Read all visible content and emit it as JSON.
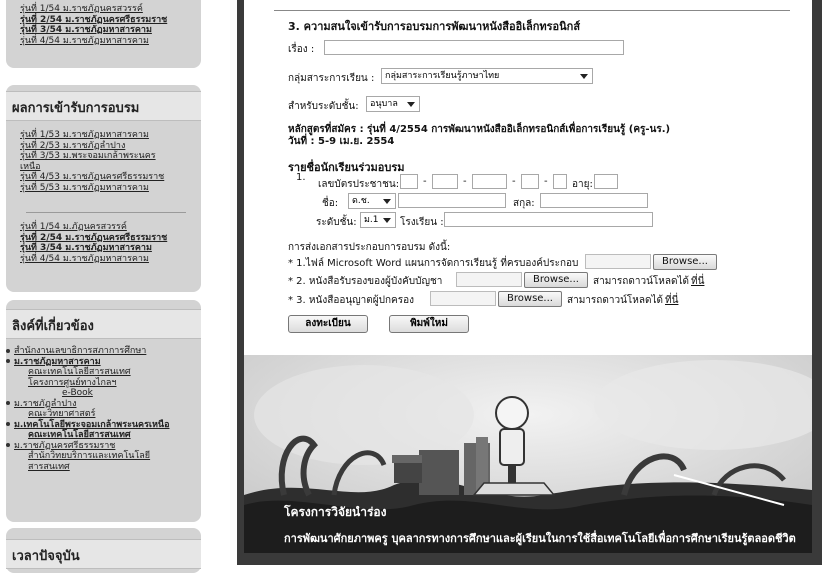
{
  "sidebar": {
    "top_links": [
      "รุ่นที่ 1/54 ม.ราชภัฏนครสวรรค์",
      "รุ่นที่ 2/54 ม.ราชภัฏนครศรีธรรมราช",
      "รุ่นที่ 3/54 ม.ราชภัฏมหาสารคาม",
      "รุ่นที่ 4/54 ม.ราชภัฏมหาสารคาม"
    ],
    "results_title": "ผลการเข้ารับการอบรม",
    "results_links_53": [
      "รุ่นที่ 1/53 ม.ราชภัฏมหาสารคาม",
      "รุ่นที่ 2/53 ม.ราชภัฏลำปาง",
      "รุ่นที่ 3/53 ม.พระจอมเกล้าพระนคร",
      "เหนือ",
      "รุ่นที่ 4/53 ม.ราชภัฏนครศรีธรรมราช",
      "รุ่นที่ 5/53 ม.ราชภัฏมหาสารคาม"
    ],
    "results_links_54": [
      "รุ่นที่ 1/54 ม.ภัฏนครสวรรค์",
      "รุ่นที่ 2/54 ม.ราชภัฏนครศรีธรรมราช",
      "รุ่นที่ 3/54 ม.ราชภัฏมหาสารคาม",
      "รุ่นที่ 4/54 ม.ราชภัฏมหาสารคาม"
    ],
    "related_title": "ลิงค์ที่เกี่ยวข้อง",
    "related": [
      {
        "label": "สำนักงานเลขาธิการสภาการศึกษา",
        "subs": []
      },
      {
        "label": "ม.ราชภัฏมหาสารคาม",
        "subs": [
          "คณะเทคโนโลยีสารสนเทศ",
          "โครงการศูนย์ทางไกลฯ",
          "e-Book"
        ]
      },
      {
        "label": "ม.ราชภัฏลำปาง",
        "subs": [
          "คณะวิทยาศาสตร์"
        ]
      },
      {
        "label": "ม.เทคโนโลยีพระจอมเกล้าพระนครเหนือ",
        "subs": [
          "คณะเทคโนโลยีสารสนเทศ"
        ]
      },
      {
        "label": "ม.ราชภัฏนครศรีธรรมราช",
        "subs": [
          "สำนักวิทยบริการและเทคโนโลยี",
          "สารสนเทศ"
        ]
      }
    ],
    "time_title": "เวลาปัจจุบัน"
  },
  "form": {
    "section_title": "3. ความสนใจเข้ารับการอบรมการพัฒนาหนังสืออิเล็กทรอนิกส์",
    "subject_label": "เรื่อง :",
    "subject_value": "",
    "subject_group_label": "กลุ่มสาระการเรียน :",
    "subject_group_value": "กลุ่มสาระการเรียนรู้ภาษาไทย",
    "level_label": "สำหรับระดับชั้น:",
    "level_value": "อนุบาล",
    "course_line1": "หลักสูตรที่สมัคร : รุ่นที่ 4/2554 การพัฒนาหนังสืออิเล็กทรอนิกส์เพื่อการเรียนรู้ (ครู-นร.)",
    "course_line2": "วันที่ : 5-9 เม.ย. 2554",
    "students_title": "รายชื่อนักเรียนร่วมอบรม",
    "student_no": "1.",
    "id_label": "เลขบัตรประชาชน:",
    "age_label": "อายุ:",
    "name_label": "ชื่อ:",
    "prefix_value": "ด.ช.",
    "surname_label": "สกุล:",
    "grade_label": "ระดับชั้น:",
    "grade_value": "ม.1",
    "school_label": "โรงเรียน :",
    "docs_title": "การส่งเอกสารประกอบการอบรม ดังนี้:",
    "doc1": "* 1.ไฟล์ Microsoft Word แผนการจัดการเรียนรู้ ที่ครบองค์ประกอบ",
    "doc2": "* 2. หนังสือรับรองของผู้บังคับบัญชา",
    "doc3": "* 3. หนังสืออนุญาตผู้ปกครอง",
    "browse_label": "Browse...",
    "download_text": "สามารถดาวน์โหลดได้",
    "here_link": "ที่นี่",
    "register_button": "ลงทะเบียน",
    "reset_button": "พิมพ์ใหม่"
  },
  "banner": {
    "line1": "โครงการวิจัยนำร่อง",
    "line2": "การพัฒนาศักยภาพครู บุคลากรทางการศึกษาและผู้เรียนในการใช้สื่อเทคโนโลยีเพื่อการศึกษาเรียนรู้ตลอดชีวิต"
  }
}
